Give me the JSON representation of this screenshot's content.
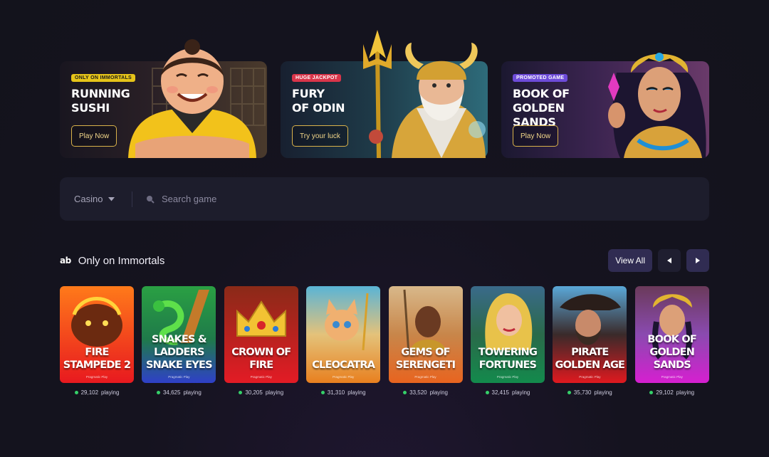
{
  "banners": [
    {
      "tag": "Only on Immortals",
      "title": "Running\nSushi",
      "cta": "Play Now",
      "tag_color": "#e6c419",
      "tag_text_color": "#1a1a1a"
    },
    {
      "tag": "Huge Jackpot",
      "title": "Fury\nof Odin",
      "cta": "Try your luck",
      "tag_color": "#d9354a",
      "tag_text_color": "#ffffff"
    },
    {
      "tag": "Promoted Game",
      "title": "Book of\nGolden Sands",
      "cta": "Play Now",
      "tag_color": "#6d4bd8",
      "tag_text_color": "#ffffff"
    }
  ],
  "search": {
    "category": "Casino",
    "placeholder": "Search game"
  },
  "section": {
    "logo": "ab",
    "title": "Only on Immortals",
    "view_all": "View All"
  },
  "games": [
    {
      "name": "Fire Stampede 2",
      "provider": "Pragmatic Play",
      "playing": "29,102",
      "playing_suffix": "playing",
      "colors": [
        "#ff7a1a",
        "#e8191f"
      ]
    },
    {
      "name": "Snakes & Ladders Snake Eyes",
      "provider": "Pragmatic Play",
      "playing": "34,625",
      "playing_suffix": "playing",
      "colors": [
        "#2aa043",
        "#2f40c8"
      ]
    },
    {
      "name": "Crown of Fire",
      "provider": "Pragmatic Play",
      "playing": "30,205",
      "playing_suffix": "playing",
      "colors": [
        "#b23a1a",
        "#e31b25"
      ]
    },
    {
      "name": "Cleocatra",
      "provider": "Pragmatic Play",
      "playing": "31,310",
      "playing_suffix": "playing",
      "colors": [
        "#5ab4d6",
        "#e8801f"
      ]
    },
    {
      "name": "Gems of Serengeti",
      "provider": "Pragmatic Play",
      "playing": "33,520",
      "playing_suffix": "playing",
      "colors": [
        "#c89a5a",
        "#e8641f"
      ]
    },
    {
      "name": "Towering Fortunes",
      "provider": "Pragmatic Play",
      "playing": "32,415",
      "playing_suffix": "playing",
      "colors": [
        "#d7c04a",
        "#138a4c"
      ]
    },
    {
      "name": "Pirate Golden Age",
      "provider": "Pragmatic Play",
      "playing": "35,730",
      "playing_suffix": "playing",
      "colors": [
        "#3c8fc0",
        "#e0191f"
      ]
    },
    {
      "name": "Book of Golden Sands",
      "provider": "Pragmatic Play",
      "playing": "29,102",
      "playing_suffix": "playing",
      "colors": [
        "#8a4ab0",
        "#d61fd0"
      ]
    }
  ]
}
